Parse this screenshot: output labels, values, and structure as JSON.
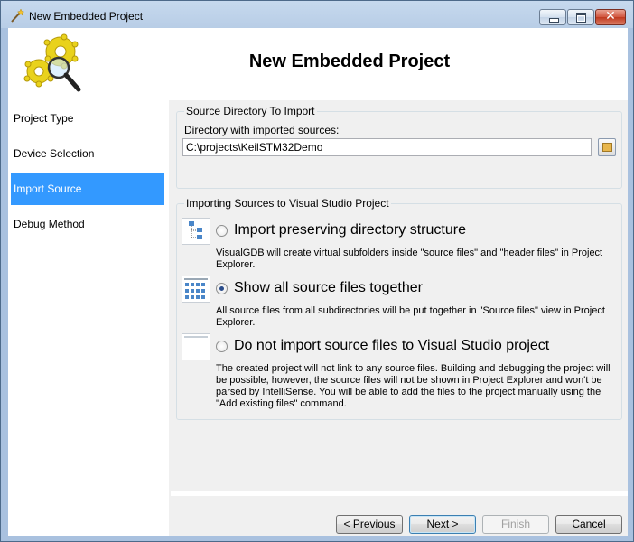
{
  "window": {
    "title": "New Embedded Project",
    "close_glyph": "✕"
  },
  "header": {
    "title": "New Embedded Project",
    "logo_icon": "gears-magnifier-icon"
  },
  "sidebar": {
    "items": [
      {
        "label": "Project Type",
        "active": false
      },
      {
        "label": "Device Selection",
        "active": false
      },
      {
        "label": "Import Source",
        "active": true
      },
      {
        "label": "Debug Method",
        "active": false
      }
    ]
  },
  "source_group": {
    "legend": "Source Directory To Import",
    "dir_label": "Directory with imported sources:",
    "dir_value": "C:\\projects\\KeilSTM32Demo"
  },
  "import_group": {
    "legend": "Importing Sources to Visual Studio Project",
    "options": [
      {
        "title": "Import preserving directory structure",
        "desc": "VisualGDB will create virtual subfolders inside \"source files\" and \"header files\" in Project Explorer.",
        "selected": false
      },
      {
        "title": "Show all source files together",
        "desc": "All source files from all subdirectories will be put together in \"Source files\" view in Project Explorer.",
        "selected": true
      },
      {
        "title": "Do not import source files to Visual Studio project",
        "desc": "The created project will not link to any source files. Building and debugging the project will be possible, however, the source files will not be shown in Project Explorer and won't be parsed by IntelliSense. You will be able to add the files to the project manually using the \"Add existing files\" command.",
        "selected": false
      }
    ]
  },
  "footer": {
    "previous": "< Previous",
    "next": "Next >",
    "finish": "Finish",
    "cancel": "Cancel"
  },
  "colors": {
    "accent": "#3399ff",
    "frame": "#a9c1df"
  }
}
